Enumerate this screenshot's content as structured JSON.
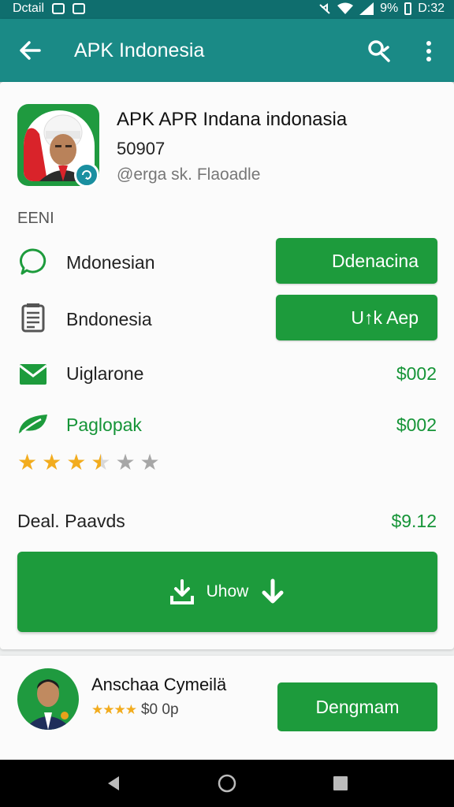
{
  "status_bar": {
    "left_text": "Dctail",
    "battery_text": "9%",
    "time": "D:32"
  },
  "app_bar": {
    "title": "APK Indonesia",
    "back_icon": "arrow-left-icon",
    "search_icon": "search-icon",
    "more_icon": "more-vert-icon"
  },
  "app_info": {
    "name": "APK APR Indana indonasia",
    "version": "50907",
    "developer": "@erga sk. Flaoadle"
  },
  "section_label": "EENI",
  "rows": [
    {
      "icon": "chat-bubble-icon",
      "label": "Mdonesian",
      "action_label": "Ddenacina"
    },
    {
      "icon": "document-icon",
      "label": "Bndonesia",
      "action_label": "U↑k Aep"
    },
    {
      "icon": "mail-icon",
      "label": "Uiglarone",
      "price": "$002"
    },
    {
      "icon": "leaf-icon",
      "label": "Paglopak",
      "price": "$002"
    }
  ],
  "rating": {
    "value": 3.5,
    "max": 6
  },
  "deal": {
    "label": "Deal. Paavds",
    "price": "$9.12"
  },
  "download_button": {
    "label": "Uhow",
    "icon": "download-icon"
  },
  "recommendation": {
    "name": "Anschaa Cymeilä",
    "rating_stars": 4,
    "price_text": "$0 0p",
    "button_label": "Dengmam"
  },
  "nav": {
    "back": "nav-back-icon",
    "home": "nav-home-icon",
    "recents": "nav-recents-icon"
  },
  "colors": {
    "primary": "#1a8a86",
    "status_bar": "#0f6e6e",
    "accent_green": "#1d9b3c",
    "star": "#f2ac1e"
  }
}
